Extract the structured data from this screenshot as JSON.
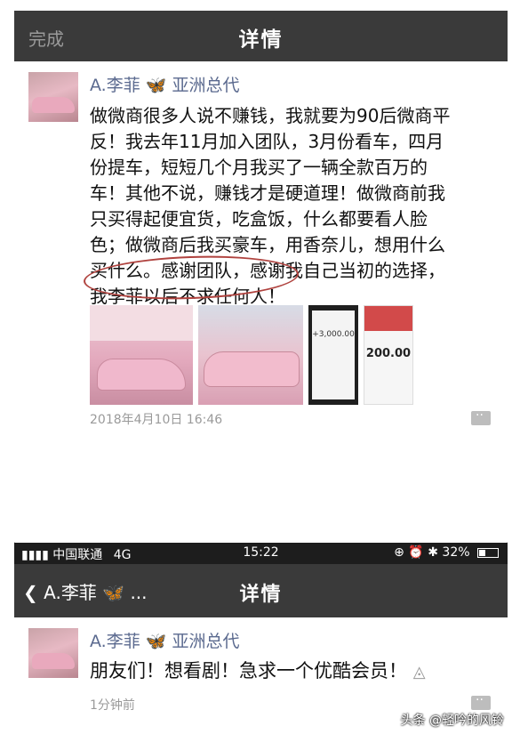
{
  "top_nav": {
    "done_label": "完成",
    "title": "详情"
  },
  "post1": {
    "name": "A.李菲",
    "butterfly_icon": "butterfly-icon",
    "name_suffix": "亚洲总代",
    "lines": [
      "做微商很多人说不赚钱，我就要为90后微商平",
      "反！我去年11月加入团队，3月份看车，四月",
      "份提车，短短几个月我买了一辆全款百万的",
      "车！其他不说，赚钱才是硬道理！做微商前我",
      "只买得起便宜货，吃盒饭，什么都要看人脸",
      "色；做微商后我买豪车，用香奈儿，想用什么",
      "买什么。感谢团队，感谢我自己当初的选择，",
      "我李菲以后不求任何人！"
    ],
    "thumb3_amount": "+3,000.00",
    "thumb4_amount": "200.00",
    "time": "2018年4月10日 16:46"
  },
  "status_bar": {
    "carrier": "中国联通",
    "network": "4G",
    "time": "15:22",
    "battery": "32%"
  },
  "second_nav": {
    "back_label": "A.李菲",
    "ellipsis": "...",
    "title": "详情"
  },
  "post2": {
    "name": "A.李菲",
    "name_suffix": "亚洲总代",
    "body": "朋友们！想看剧！急求一个优酷会员！",
    "time": "1分钟前"
  },
  "watermark": "头条 @轻吟的风铃",
  "colors": {
    "navbar": "#3a3a3a",
    "name": "#5b6a8f",
    "circle": "#b0433f"
  }
}
